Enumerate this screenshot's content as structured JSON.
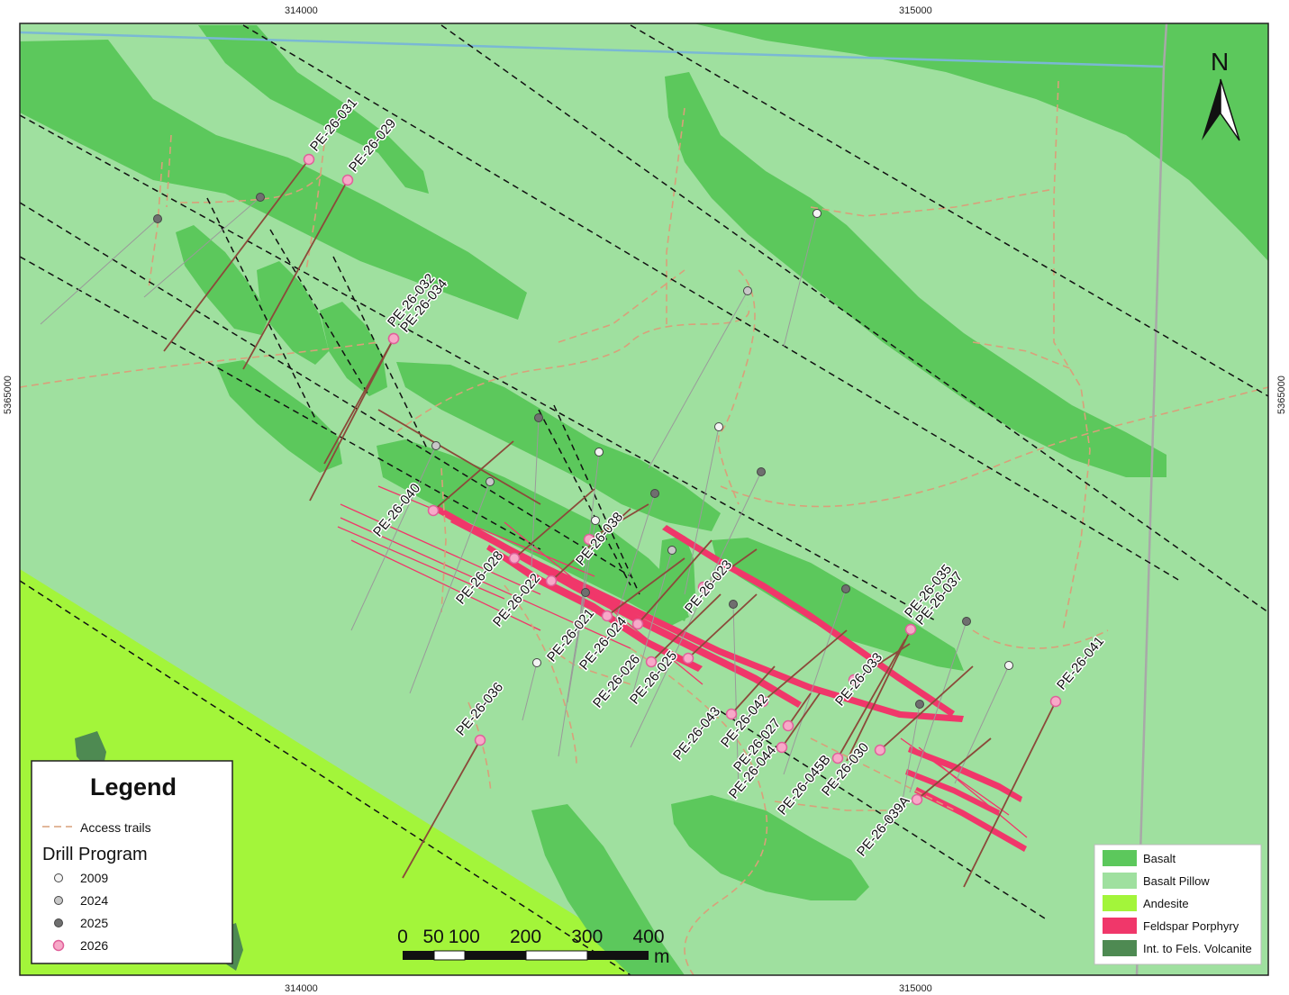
{
  "colors": {
    "basalt": "#5cc85c",
    "basalt_pillow": "#9fe09f",
    "andesite": "#a3f53a",
    "feldspar_porphyry": "#f0376a",
    "int_fels_volcanite": "#4e8a52",
    "access_trail": "#d9a07a",
    "hole_2009": "#f4f4f4",
    "hole_2024": "#c8c8c8",
    "hole_2025": "#6f6f6f",
    "hole_2026": "#f7a9c8",
    "drill_trace_2026": "#8b4a3a",
    "drill_trace_old": "#9a9a9a",
    "boundary_blue": "#7ab8d4",
    "boundary_gray": "#a8a8a8"
  },
  "grid": {
    "easting_labels": [
      "314000",
      "315000"
    ],
    "northing_labels": [
      "5365000"
    ]
  },
  "north_arrow": {
    "label": "N"
  },
  "scale_bar": {
    "ticks": [
      "0",
      "50",
      "100",
      "200",
      "300",
      "400"
    ],
    "unit": "m"
  },
  "legend": {
    "title": "Legend",
    "trail_label": "Access trails",
    "drill_program_title": "Drill Program",
    "drill_years": [
      {
        "label": "2009",
        "color_key": "hole_2009"
      },
      {
        "label": "2024",
        "color_key": "hole_2024"
      },
      {
        "label": "2025",
        "color_key": "hole_2025"
      },
      {
        "label": "2026",
        "color_key": "hole_2026"
      }
    ]
  },
  "geology_legend": [
    {
      "label": "Basalt",
      "color_key": "basalt"
    },
    {
      "label": "Basalt Pillow",
      "color_key": "basalt_pillow"
    },
    {
      "label": "Andesite",
      "color_key": "andesite"
    },
    {
      "label": "Feldspar Porphyry",
      "color_key": "feldspar_porphyry"
    },
    {
      "label": "Int. to Fels. Volcanite",
      "color_key": "int_fels_volcanite"
    }
  ],
  "drill_holes_2026": [
    "PE-26-031",
    "PE-26-029",
    "PE-26-032",
    "PE-26-034",
    "PE-26-040",
    "PE-26-038",
    "PE-26-028",
    "PE-26-022",
    "PE-26-021",
    "PE-26-024",
    "PE-26-026",
    "PE-26-025",
    "PE-26-023",
    "PE-26-036",
    "PE-26-043",
    "PE-26-042",
    "PE-26-027",
    "PE-26-044",
    "PE-26-045B",
    "PE-26-030",
    "PE-26-033",
    "PE-26-035",
    "PE-26-037",
    "PE-26-039A",
    "PE-26-041"
  ]
}
